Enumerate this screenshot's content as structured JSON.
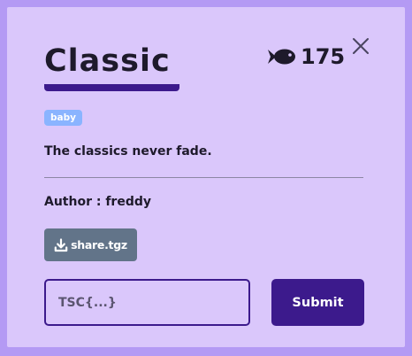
{
  "challenge": {
    "title": "Classic",
    "points": "175",
    "points_icon": "fish-icon",
    "tag": "baby",
    "description": "The classics never fade.",
    "author": "Author : freddy"
  },
  "download": {
    "label": "share.tgz",
    "icon": "download-icon"
  },
  "flag_form": {
    "placeholder": "TSC{...}",
    "value": "",
    "submit_label": "Submit"
  },
  "colors": {
    "backdrop": "#b49af4",
    "modal_background": "#dac7fb",
    "accent": "#3c1a8c",
    "tag_background": "#8ab4ff",
    "download_button": "#627489",
    "text": "#1e1a2b"
  }
}
